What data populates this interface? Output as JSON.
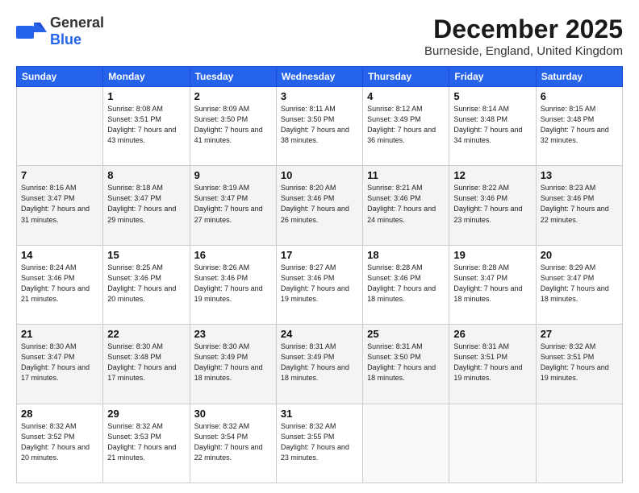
{
  "header": {
    "logo_general": "General",
    "logo_blue": "Blue",
    "month": "December 2025",
    "location": "Burneside, England, United Kingdom"
  },
  "weekdays": [
    "Sunday",
    "Monday",
    "Tuesday",
    "Wednesday",
    "Thursday",
    "Friday",
    "Saturday"
  ],
  "weeks": [
    [
      {
        "day": "",
        "sunrise": "",
        "sunset": "",
        "daylight": ""
      },
      {
        "day": "1",
        "sunrise": "Sunrise: 8:08 AM",
        "sunset": "Sunset: 3:51 PM",
        "daylight": "Daylight: 7 hours and 43 minutes."
      },
      {
        "day": "2",
        "sunrise": "Sunrise: 8:09 AM",
        "sunset": "Sunset: 3:50 PM",
        "daylight": "Daylight: 7 hours and 41 minutes."
      },
      {
        "day": "3",
        "sunrise": "Sunrise: 8:11 AM",
        "sunset": "Sunset: 3:50 PM",
        "daylight": "Daylight: 7 hours and 38 minutes."
      },
      {
        "day": "4",
        "sunrise": "Sunrise: 8:12 AM",
        "sunset": "Sunset: 3:49 PM",
        "daylight": "Daylight: 7 hours and 36 minutes."
      },
      {
        "day": "5",
        "sunrise": "Sunrise: 8:14 AM",
        "sunset": "Sunset: 3:48 PM",
        "daylight": "Daylight: 7 hours and 34 minutes."
      },
      {
        "day": "6",
        "sunrise": "Sunrise: 8:15 AM",
        "sunset": "Sunset: 3:48 PM",
        "daylight": "Daylight: 7 hours and 32 minutes."
      }
    ],
    [
      {
        "day": "7",
        "sunrise": "Sunrise: 8:16 AM",
        "sunset": "Sunset: 3:47 PM",
        "daylight": "Daylight: 7 hours and 31 minutes."
      },
      {
        "day": "8",
        "sunrise": "Sunrise: 8:18 AM",
        "sunset": "Sunset: 3:47 PM",
        "daylight": "Daylight: 7 hours and 29 minutes."
      },
      {
        "day": "9",
        "sunrise": "Sunrise: 8:19 AM",
        "sunset": "Sunset: 3:47 PM",
        "daylight": "Daylight: 7 hours and 27 minutes."
      },
      {
        "day": "10",
        "sunrise": "Sunrise: 8:20 AM",
        "sunset": "Sunset: 3:46 PM",
        "daylight": "Daylight: 7 hours and 26 minutes."
      },
      {
        "day": "11",
        "sunrise": "Sunrise: 8:21 AM",
        "sunset": "Sunset: 3:46 PM",
        "daylight": "Daylight: 7 hours and 24 minutes."
      },
      {
        "day": "12",
        "sunrise": "Sunrise: 8:22 AM",
        "sunset": "Sunset: 3:46 PM",
        "daylight": "Daylight: 7 hours and 23 minutes."
      },
      {
        "day": "13",
        "sunrise": "Sunrise: 8:23 AM",
        "sunset": "Sunset: 3:46 PM",
        "daylight": "Daylight: 7 hours and 22 minutes."
      }
    ],
    [
      {
        "day": "14",
        "sunrise": "Sunrise: 8:24 AM",
        "sunset": "Sunset: 3:46 PM",
        "daylight": "Daylight: 7 hours and 21 minutes."
      },
      {
        "day": "15",
        "sunrise": "Sunrise: 8:25 AM",
        "sunset": "Sunset: 3:46 PM",
        "daylight": "Daylight: 7 hours and 20 minutes."
      },
      {
        "day": "16",
        "sunrise": "Sunrise: 8:26 AM",
        "sunset": "Sunset: 3:46 PM",
        "daylight": "Daylight: 7 hours and 19 minutes."
      },
      {
        "day": "17",
        "sunrise": "Sunrise: 8:27 AM",
        "sunset": "Sunset: 3:46 PM",
        "daylight": "Daylight: 7 hours and 19 minutes."
      },
      {
        "day": "18",
        "sunrise": "Sunrise: 8:28 AM",
        "sunset": "Sunset: 3:46 PM",
        "daylight": "Daylight: 7 hours and 18 minutes."
      },
      {
        "day": "19",
        "sunrise": "Sunrise: 8:28 AM",
        "sunset": "Sunset: 3:47 PM",
        "daylight": "Daylight: 7 hours and 18 minutes."
      },
      {
        "day": "20",
        "sunrise": "Sunrise: 8:29 AM",
        "sunset": "Sunset: 3:47 PM",
        "daylight": "Daylight: 7 hours and 18 minutes."
      }
    ],
    [
      {
        "day": "21",
        "sunrise": "Sunrise: 8:30 AM",
        "sunset": "Sunset: 3:47 PM",
        "daylight": "Daylight: 7 hours and 17 minutes."
      },
      {
        "day": "22",
        "sunrise": "Sunrise: 8:30 AM",
        "sunset": "Sunset: 3:48 PM",
        "daylight": "Daylight: 7 hours and 17 minutes."
      },
      {
        "day": "23",
        "sunrise": "Sunrise: 8:30 AM",
        "sunset": "Sunset: 3:49 PM",
        "daylight": "Daylight: 7 hours and 18 minutes."
      },
      {
        "day": "24",
        "sunrise": "Sunrise: 8:31 AM",
        "sunset": "Sunset: 3:49 PM",
        "daylight": "Daylight: 7 hours and 18 minutes."
      },
      {
        "day": "25",
        "sunrise": "Sunrise: 8:31 AM",
        "sunset": "Sunset: 3:50 PM",
        "daylight": "Daylight: 7 hours and 18 minutes."
      },
      {
        "day": "26",
        "sunrise": "Sunrise: 8:31 AM",
        "sunset": "Sunset: 3:51 PM",
        "daylight": "Daylight: 7 hours and 19 minutes."
      },
      {
        "day": "27",
        "sunrise": "Sunrise: 8:32 AM",
        "sunset": "Sunset: 3:51 PM",
        "daylight": "Daylight: 7 hours and 19 minutes."
      }
    ],
    [
      {
        "day": "28",
        "sunrise": "Sunrise: 8:32 AM",
        "sunset": "Sunset: 3:52 PM",
        "daylight": "Daylight: 7 hours and 20 minutes."
      },
      {
        "day": "29",
        "sunrise": "Sunrise: 8:32 AM",
        "sunset": "Sunset: 3:53 PM",
        "daylight": "Daylight: 7 hours and 21 minutes."
      },
      {
        "day": "30",
        "sunrise": "Sunrise: 8:32 AM",
        "sunset": "Sunset: 3:54 PM",
        "daylight": "Daylight: 7 hours and 22 minutes."
      },
      {
        "day": "31",
        "sunrise": "Sunrise: 8:32 AM",
        "sunset": "Sunset: 3:55 PM",
        "daylight": "Daylight: 7 hours and 23 minutes."
      },
      {
        "day": "",
        "sunrise": "",
        "sunset": "",
        "daylight": ""
      },
      {
        "day": "",
        "sunrise": "",
        "sunset": "",
        "daylight": ""
      },
      {
        "day": "",
        "sunrise": "",
        "sunset": "",
        "daylight": ""
      }
    ]
  ]
}
